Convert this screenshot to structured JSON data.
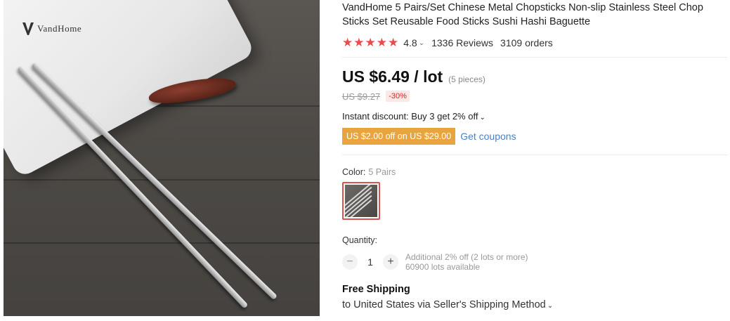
{
  "product_image": {
    "brand": "VandHome"
  },
  "product": {
    "title": "VandHome 5 Pairs/Set Chinese Metal Chopsticks Non-slip Stainless Steel Chop Sticks Set Reusable Food Sticks Sushi Hashi Baguette",
    "stars_icon": "star-icon",
    "rating": "4.8",
    "reviews": "1336 Reviews",
    "orders": "3109 orders",
    "price": "US $6.49 / lot",
    "pieces": "(5 pieces)",
    "old_price": "US $9.27",
    "discount": "-30%",
    "instant_discount": "Instant discount: Buy 3 get 2% off",
    "coupon": "US $2.00 off on US $29.00",
    "get_coupons": "Get coupons",
    "color_label": "Color:",
    "color_value": "5 Pairs",
    "quantity_label": "Quantity:",
    "quantity": "1",
    "qty_note_1": "Additional 2% off (2 lots or more)",
    "qty_note_2": "60900 lots available",
    "shipping_title": "Free Shipping",
    "shipping_sub": "to United States via Seller's Shipping Method"
  },
  "colors": {
    "star": "#e94a4a",
    "coupon_bg": "#e8a43e",
    "link": "#4b7fc4",
    "discount_text": "#e02020",
    "selected_border": "#d9534f"
  }
}
